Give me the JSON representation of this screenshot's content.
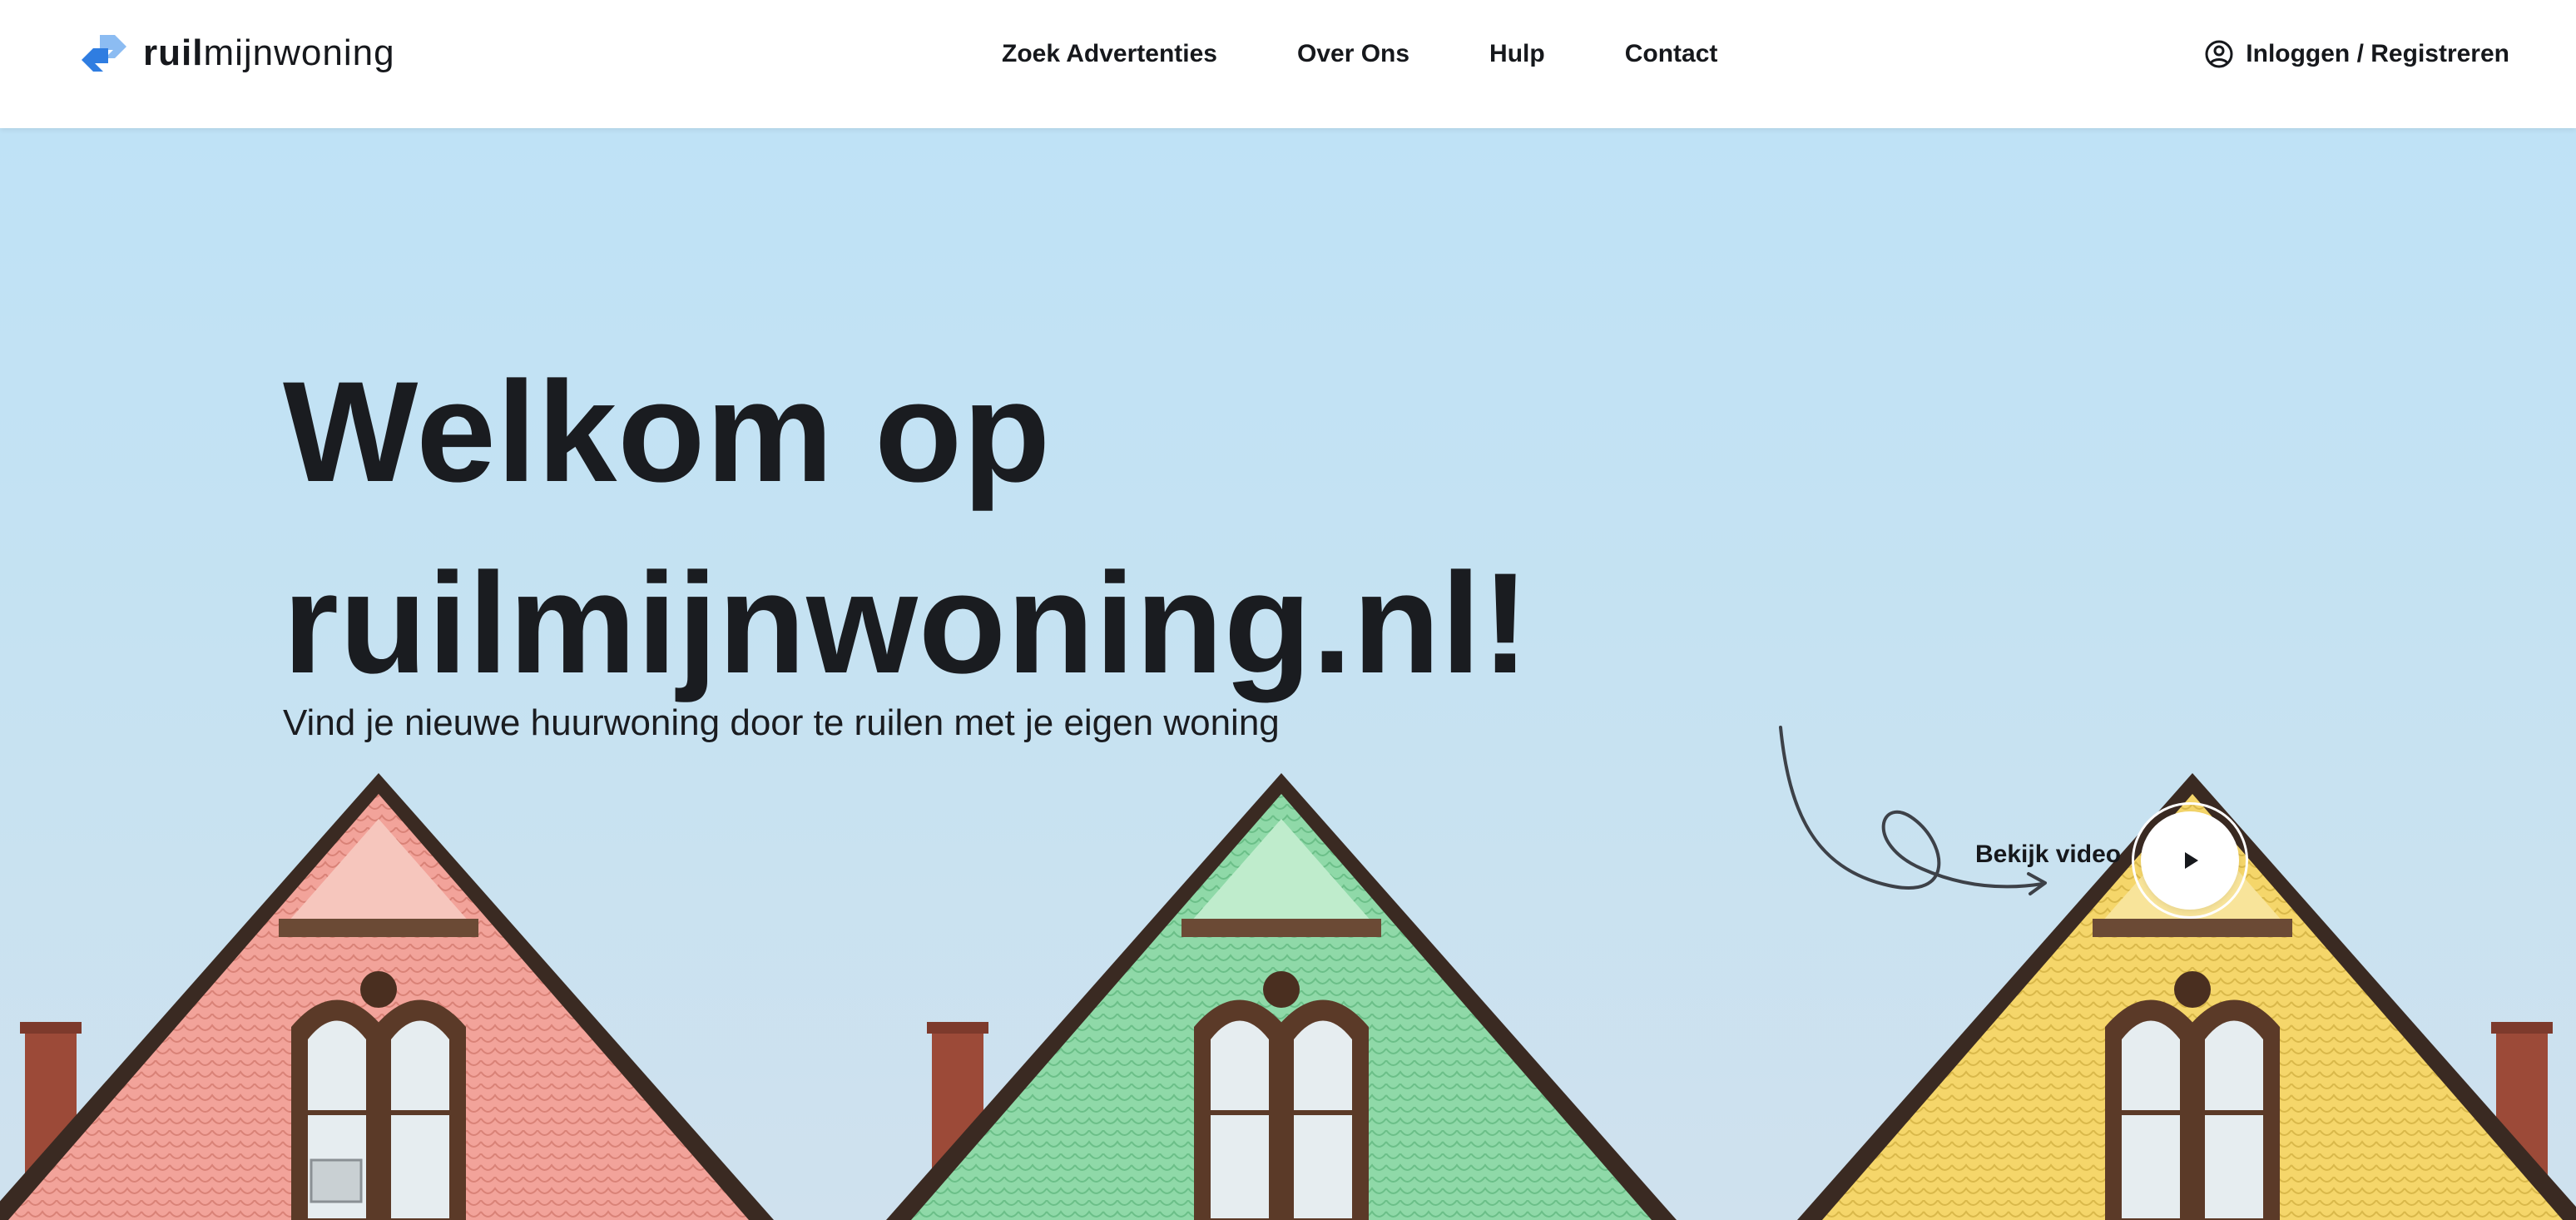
{
  "brand": {
    "name_bold": "ruil",
    "name_light": "mijnwoning",
    "logo_icon": "swap-arrows-icon",
    "colors": {
      "logo_dark": "#2f7de1",
      "logo_light": "#8cbcf2"
    }
  },
  "nav": {
    "items": [
      {
        "label": "Zoek Advertenties"
      },
      {
        "label": "Over Ons"
      },
      {
        "label": "Hulp"
      },
      {
        "label": "Contact"
      }
    ]
  },
  "account": {
    "label": "Inloggen / Registreren",
    "icon": "user-circle-icon"
  },
  "hero": {
    "title_line1": "Welkom op",
    "title_line2": "ruilmijnwoning.nl!",
    "subtitle": "Vind je nieuwe huurwoning door te ruilen met je eigen woning",
    "video_label": "Bekijk video",
    "video_icon": "play-icon",
    "background": "three-colorful-house-gables-photo",
    "colors": {
      "house_pink": "#f2a39a",
      "house_green": "#8fd9a8",
      "house_yellow": "#f5d66a",
      "sky": "#c4e2f3"
    }
  }
}
